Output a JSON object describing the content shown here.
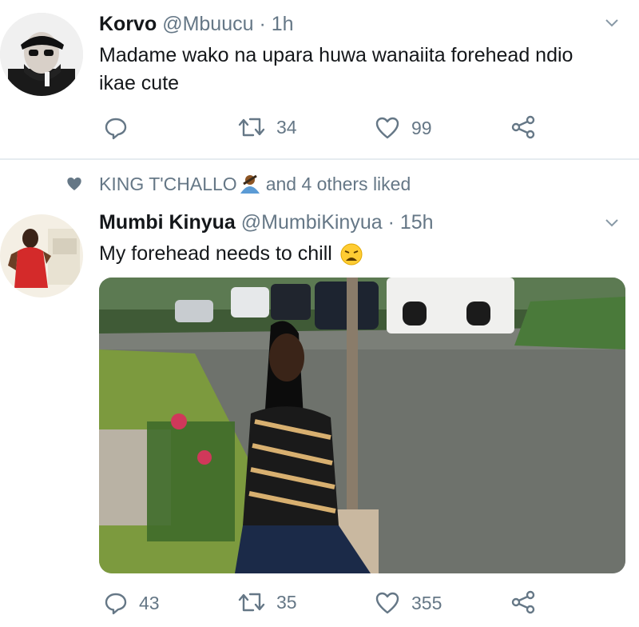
{
  "tweet1": {
    "display_name": "Korvo",
    "handle": "@Mbuucu",
    "separator": "·",
    "time": "1h",
    "text_line1": "Madame wako na upara huwa wanaiita forehead ndio",
    "text_line2": "ikae cute",
    "reply_count": "",
    "retweet_count": "34",
    "like_count": "99"
  },
  "social_context": {
    "liker": "KING T'CHALLO",
    "rest": "and 4 others liked"
  },
  "tweet2": {
    "display_name": "Mumbi Kinyua",
    "handle": "@MumbiKinyua",
    "separator": "·",
    "time": "15h",
    "text": "My forehead needs to chill",
    "reply_count": "43",
    "retweet_count": "35",
    "like_count": "355"
  },
  "icons": {
    "reply": "reply-icon",
    "retweet": "retweet-icon",
    "like": "heart-icon",
    "share": "share-icon",
    "more": "chevron-down-icon",
    "liked": "heart-filled-icon",
    "emoji_person": "person-emoji-icon",
    "emoji_weary": "weary-face-emoji-icon"
  },
  "colors": {
    "text_primary": "#14171a",
    "text_secondary": "#657786",
    "divider": "#e6ecf0"
  }
}
